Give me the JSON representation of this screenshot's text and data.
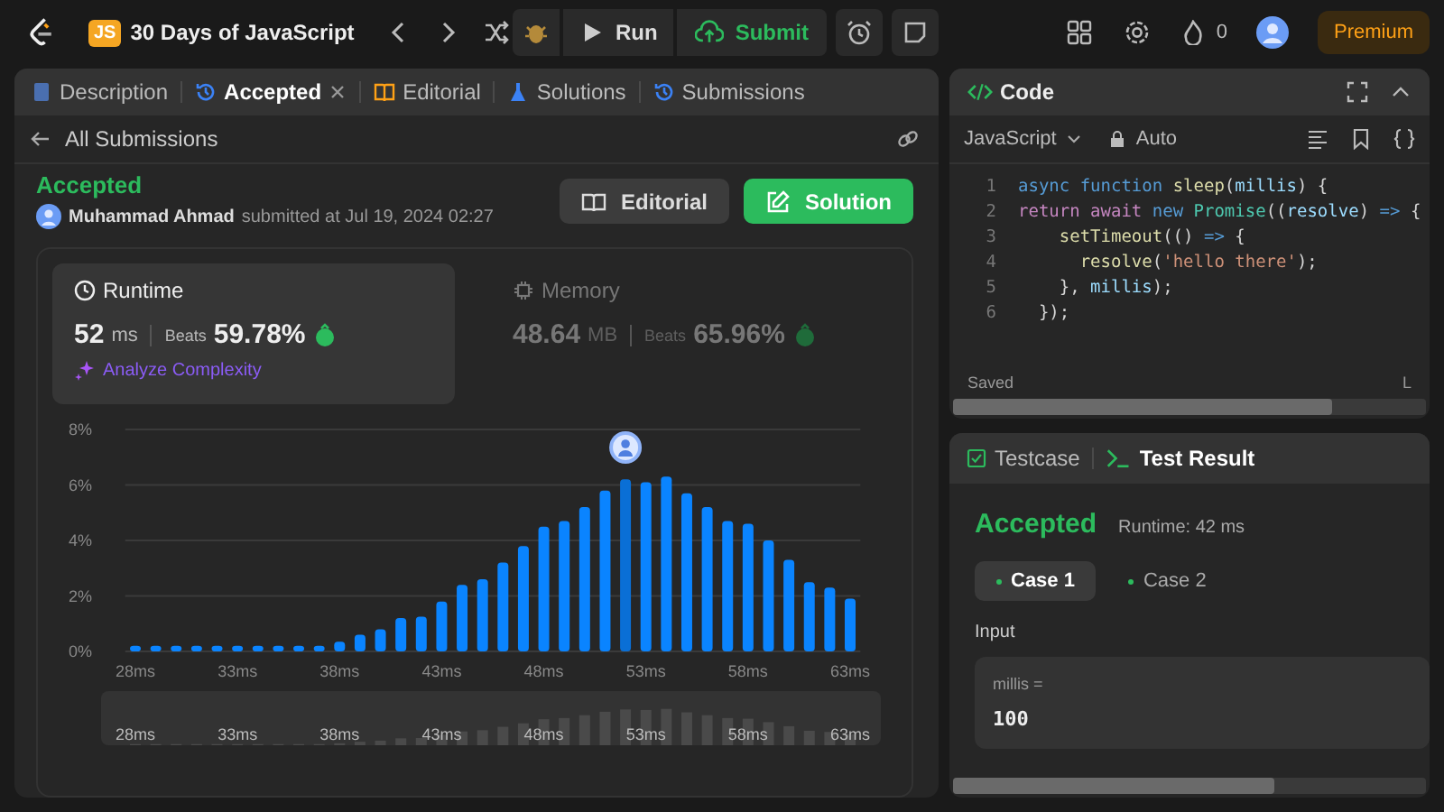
{
  "top_bar": {
    "logo_text": "JS",
    "title": "30 Days of JavaScript",
    "run": "Run",
    "submit": "Submit",
    "streak": "0",
    "premium": "Premium"
  },
  "tabs": [
    {
      "label": "Description",
      "selected": false,
      "closable": false
    },
    {
      "label": "Accepted",
      "selected": true,
      "closable": true
    },
    {
      "label": "Editorial",
      "selected": false,
      "closable": false
    },
    {
      "label": "Solutions",
      "selected": false,
      "closable": false
    },
    {
      "label": "Submissions",
      "selected": false,
      "closable": false
    }
  ],
  "back_link": "All Submissions",
  "submission": {
    "status": "Accepted",
    "author": "Muhammad Ahmad",
    "submitted": "submitted at Jul 19, 2024 02:27"
  },
  "buttons": [
    {
      "label": "Editorial",
      "kind": "secondary"
    },
    {
      "label": "Solution",
      "kind": "primary"
    }
  ],
  "metrics": [
    {
      "title": "Runtime",
      "value": "52",
      "unit": "ms",
      "beats_label": "Beats",
      "beats": "59.78%",
      "selected": true
    },
    {
      "title": "Memory",
      "value": "48.64",
      "unit": "MB",
      "beats_label": "Beats",
      "beats": "65.96%",
      "selected": false
    }
  ],
  "analyze": "Analyze Complexity",
  "chart_data": {
    "type": "bar",
    "x": [
      28,
      29,
      30,
      31,
      32,
      33,
      34,
      35,
      36,
      37,
      38,
      39,
      40,
      41,
      42,
      43,
      44,
      45,
      46,
      47,
      48,
      49,
      50,
      51,
      52,
      53,
      54,
      55,
      56,
      57,
      58,
      59,
      60,
      61,
      62,
      63
    ],
    "values": [
      0.2,
      0.2,
      0.2,
      0.2,
      0.2,
      0.2,
      0.2,
      0.2,
      0.2,
      0.2,
      0.35,
      0.6,
      0.8,
      1.2,
      1.25,
      1.8,
      2.4,
      2.6,
      3.2,
      3.8,
      4.5,
      4.7,
      5.2,
      5.8,
      6.2,
      6.1,
      6.3,
      5.7,
      5.2,
      4.7,
      4.6,
      4.0,
      3.3,
      2.5,
      2.3,
      1.9
    ],
    "xlim": [
      27.5,
      63.5
    ],
    "ylim": [
      0,
      8
    ],
    "grid": true,
    "yticks": [
      {
        "value": 0,
        "label": "0%"
      },
      {
        "value": 2,
        "label": "2%"
      },
      {
        "value": 4,
        "label": "4%"
      },
      {
        "value": 6,
        "label": "6%"
      },
      {
        "value": 8,
        "label": "8%"
      }
    ],
    "xticks": [
      {
        "value": 28,
        "label": "28ms"
      },
      {
        "value": 33,
        "label": "33ms"
      },
      {
        "value": 38,
        "label": "38ms"
      },
      {
        "value": 43,
        "label": "43ms"
      },
      {
        "value": 48,
        "label": "48ms"
      },
      {
        "value": 53,
        "label": "53ms"
      },
      {
        "value": 58,
        "label": "58ms"
      },
      {
        "value": 63,
        "label": "63ms"
      }
    ],
    "orientation": "vertical"
  },
  "overview_labels": [
    "28ms",
    "33ms",
    "38ms",
    "43ms",
    "48ms",
    "53ms",
    "58ms",
    "63ms"
  ],
  "code": {
    "title": "Code",
    "language": "JavaScript",
    "mode": "Auto",
    "status": "Saved",
    "status_right": "L",
    "lines": [
      {
        "number": "1",
        "tokens": [
          {
            "t": "async ",
            "kind": "keyword"
          },
          {
            "t": "function ",
            "kind": "keyword"
          },
          {
            "t": "sleep",
            "kind": "function"
          },
          {
            "t": "(",
            "kind": "plain"
          },
          {
            "t": "millis",
            "kind": "variable"
          },
          {
            "t": ") {",
            "kind": "plain"
          }
        ]
      },
      {
        "number": "2",
        "tokens": [
          {
            "t": "return ",
            "kind": "control"
          },
          {
            "t": "await ",
            "kind": "control"
          },
          {
            "t": "new ",
            "kind": "keyword"
          },
          {
            "t": "Promise",
            "kind": "type"
          },
          {
            "t": "((",
            "kind": "plain"
          },
          {
            "t": "resolve",
            "kind": "variable"
          },
          {
            "t": ") ",
            "kind": "plain"
          },
          {
            "t": "=>",
            "kind": "keyword"
          },
          {
            "t": " {",
            "kind": "plain"
          }
        ]
      },
      {
        "number": "3",
        "tokens": [
          {
            "t": "    setTimeout",
            "kind": "function"
          },
          {
            "t": "(() ",
            "kind": "plain"
          },
          {
            "t": "=>",
            "kind": "keyword"
          },
          {
            "t": " {",
            "kind": "plain"
          }
        ]
      },
      {
        "number": "4",
        "tokens": [
          {
            "t": "      resolve",
            "kind": "function"
          },
          {
            "t": "(",
            "kind": "plain"
          },
          {
            "t": "'hello there'",
            "kind": "string"
          },
          {
            "t": ");",
            "kind": "plain"
          }
        ]
      },
      {
        "number": "5",
        "tokens": [
          {
            "t": "    }, ",
            "kind": "plain"
          },
          {
            "t": "millis",
            "kind": "variable"
          },
          {
            "t": ");",
            "kind": "plain"
          }
        ]
      },
      {
        "number": "6",
        "tokens": [
          {
            "t": "  });",
            "kind": "plain"
          }
        ]
      }
    ]
  },
  "test_tabs": [
    {
      "label": "Testcase",
      "selected": false
    },
    {
      "label": "Test Result",
      "selected": true
    }
  ],
  "result": {
    "status": "Accepted",
    "runtime": "Runtime: 42 ms"
  },
  "cases": [
    {
      "label": "Case 1",
      "selected": true
    },
    {
      "label": "Case 2",
      "selected": false
    }
  ],
  "input_label": "Input",
  "params": [
    {
      "name": "millis =",
      "value": "100"
    }
  ]
}
